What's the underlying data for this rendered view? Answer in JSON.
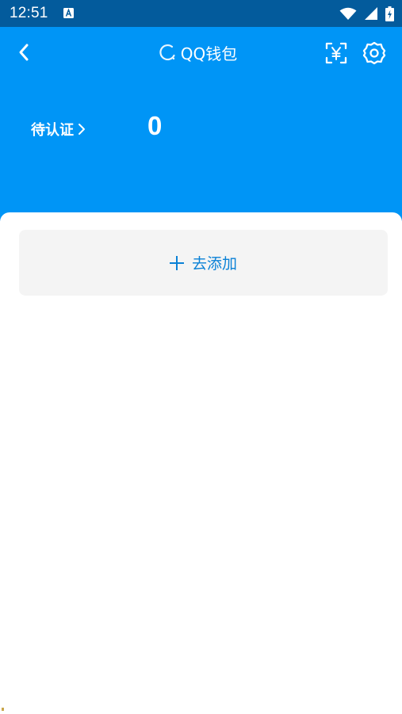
{
  "status_bar": {
    "time": "12:51",
    "icons": [
      "a-notification-icon",
      "wifi-icon",
      "signal-icon",
      "battery-icon"
    ]
  },
  "header": {
    "title": "QQ钱包",
    "back_icon": "back-arrow-icon",
    "loading_icon": "loading-spinner-icon",
    "yuan_icon": "yuan-scan-icon",
    "settings_icon": "gear-icon",
    "background_color": "#0095f6"
  },
  "pending": {
    "label": "待认证",
    "count": "0"
  },
  "add_card": {
    "label": "去添加",
    "icon": "plus-icon"
  },
  "colors": {
    "status_bar": "#035b9c",
    "header": "#0095f6",
    "accent_text": "#0a81d6",
    "card_bg": "#f4f4f4"
  }
}
